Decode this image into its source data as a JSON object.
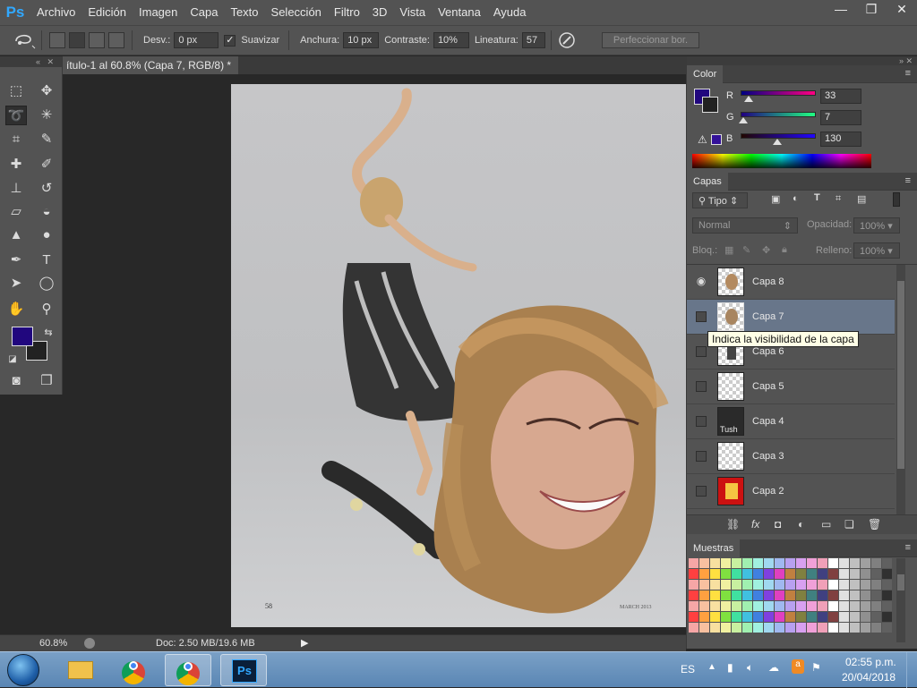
{
  "app": {
    "logo": "Ps",
    "accent": "#31a8ff"
  },
  "menu": [
    "Archivo",
    "Edición",
    "Imagen",
    "Capa",
    "Texto",
    "Selección",
    "Filtro",
    "3D",
    "Vista",
    "Ventana",
    "Ayuda"
  ],
  "window_controls": {
    "minimize": "—",
    "restore": "❐",
    "close": "✕"
  },
  "options": {
    "tool_icon": "magnetic-lasso-icon",
    "feather_label": "Desv.:",
    "feather_value": "0 px",
    "antialias_label": "Suavizar",
    "antialias_checked": true,
    "width_label": "Anchura:",
    "width_value": "10 px",
    "contrast_label": "Contraste:",
    "contrast_value": "10%",
    "frequency_label": "Lineatura:",
    "frequency_value": "57",
    "refine_label": "Perfeccionar bor."
  },
  "document": {
    "tab_title": "ítulo-1 al 60.8% (Capa 7, RGB/8) *",
    "close": "×",
    "page_number": "58",
    "footer_text": "MARCH 2013"
  },
  "tools": [
    "marquee",
    "move",
    "magnetic-lasso",
    "magic-wand",
    "crop",
    "eyedropper",
    "healing-brush",
    "brush",
    "clone-stamp",
    "history-brush",
    "eraser",
    "paint-bucket",
    "blur",
    "dodge",
    "pen",
    "type",
    "path-selection",
    "ellipse",
    "hand",
    "zoom"
  ],
  "colors": {
    "foreground": "#21077e",
    "background": "#222222",
    "accent": "#31a8ff"
  },
  "color_panel": {
    "tab": "Color",
    "r_label": "R",
    "r_value": "33",
    "g_label": "G",
    "g_value": "7",
    "b_label": "B",
    "b_value": "130"
  },
  "layers_panel": {
    "tab": "Capas",
    "filter": "Tipo",
    "blend_mode": "Normal",
    "opacity_label": "Opacidad:",
    "opacity_value": "100%",
    "lock_label": "Bloq.:",
    "fill_label": "Relleno:",
    "fill_value": "100%",
    "layers": [
      {
        "name": "Capa 8",
        "visible": true,
        "selected": false,
        "thumb": "photo"
      },
      {
        "name": "Capa 7",
        "visible": false,
        "selected": true,
        "thumb": "photo"
      },
      {
        "name": "Capa 6",
        "visible": false,
        "selected": false,
        "thumb": "photo"
      },
      {
        "name": "Capa 5",
        "visible": false,
        "selected": false,
        "thumb": "transparent"
      },
      {
        "name": "Capa 4",
        "visible": false,
        "selected": false,
        "thumb": "dark-photo"
      },
      {
        "name": "Capa 3",
        "visible": false,
        "selected": false,
        "thumb": "transparent"
      },
      {
        "name": "Capa 2",
        "visible": false,
        "selected": false,
        "thumb": "red-photo"
      }
    ],
    "thumb_text_4": "Tush"
  },
  "tooltip": "Indica la visibilidad de la capa",
  "swatches_panel": {
    "tab": "Muestras"
  },
  "swatch_colors": [
    "#f6a6a6",
    "#f8c0a0",
    "#f8e0a0",
    "#f0f0a0",
    "#c8f0a0",
    "#a0f0b0",
    "#a0f0e0",
    "#a0d8f0",
    "#a0b8f0",
    "#b8a0f0",
    "#d8a0f0",
    "#f0a0d8",
    "#f0a0b8",
    "#ffffff",
    "#e0e0e0",
    "#c0c0c0",
    "#a0a0a0",
    "#808080",
    "#606060"
  ],
  "status": {
    "zoom": "60.8%",
    "doc_info": "Doc: 2.50 MB/19.6 MB"
  },
  "taskbar": {
    "language": "ES",
    "time": "02:55 p.m.",
    "date": "20/04/2018"
  }
}
